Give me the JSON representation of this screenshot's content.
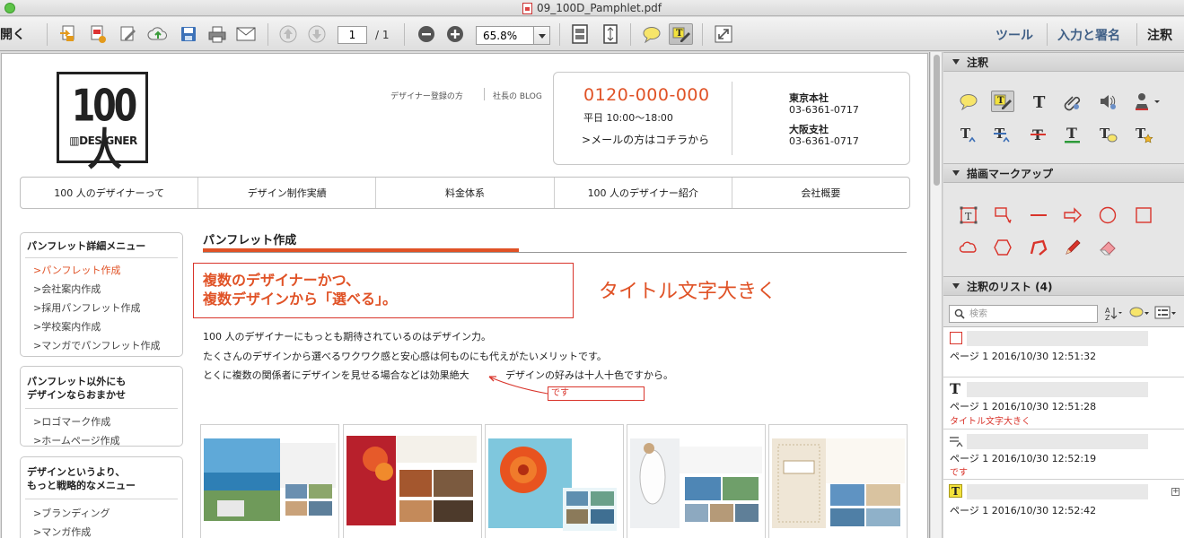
{
  "window": {
    "title": "09_100D_Pamphlet.pdf"
  },
  "toolbar": {
    "open_label": "開く",
    "page_current": "1",
    "page_total": "/ 1",
    "zoom": "65.8%",
    "tabs": [
      "ツール",
      "入力と署名",
      "注釈"
    ]
  },
  "doc": {
    "logo": {
      "big": "100人",
      "small": "▥DESIGNER"
    },
    "top_links": [
      "デザイナー登録の方",
      "社長の BLOG"
    ],
    "contact": {
      "phone": "0120-000-000",
      "hours": "平日 10:00～18:00",
      "mail": "メールの方はコチラから",
      "offices": [
        {
          "name": "東京本社",
          "tel": "03-6361-0717"
        },
        {
          "name": "大阪支社",
          "tel": "03-6361-0717"
        }
      ]
    },
    "nav": [
      "100 人のデザイナーって",
      "デザイン制作実績",
      "料金体系",
      "100 人のデザイナー紹介",
      "会社概要"
    ],
    "sidebar": [
      {
        "title": "パンフレット詳細メニュー",
        "links": [
          "パンフレット作成",
          "会社案内作成",
          "採用パンフレット作成",
          "学校案内作成",
          "マンガでパンフレット作成"
        ]
      },
      {
        "title": "パンフレット以外にも\nデザインならおまかせ",
        "links": [
          "ロゴマーク作成",
          "ホームページ作成"
        ]
      },
      {
        "title": "デザインというより、\nもっと戦略的なメニュー",
        "links": [
          "ブランディング",
          "マンガ作成"
        ]
      }
    ],
    "section_title": "パンフレット作成",
    "headline": [
      "複数のデザイナーかつ、",
      "複数デザインから「選べる」。"
    ],
    "handwritten_note": "タイトル文字大きく",
    "body": [
      "100 人のデザイナーにもっとも期待されているのはデザイン力。",
      "たくさんのデザインから選べるワクワク感と安心感は何ものにも代えがたいメリットです。",
      "とくに複数の関係者にデザインを見せる場合などは効果絶大",
      "デザインの好みは十人十色ですから。"
    ],
    "inserted_note": "です"
  },
  "panel": {
    "sections": [
      "注釈",
      "描画マークアップ",
      "注釈のリスト (4)"
    ],
    "search_placeholder": "検索",
    "comments": [
      {
        "icon": "rectangle-comment-icon",
        "meta": "ページ 1  2016/10/30 12:51:32",
        "text": ""
      },
      {
        "icon": "text-box-icon",
        "meta": "ページ 1  2016/10/30 12:51:28",
        "text": "タイトル文字大きく"
      },
      {
        "icon": "insert-text-icon",
        "meta": "ページ 1  2016/10/30 12:52:19",
        "text": "です"
      },
      {
        "icon": "highlight-text-icon",
        "meta": "ページ 1  2016/10/30 12:52:42",
        "text": ""
      }
    ]
  },
  "colors": {
    "accent": "#e05226",
    "markup_red": "#d9342b",
    "link_blue": "#3f5f86"
  }
}
